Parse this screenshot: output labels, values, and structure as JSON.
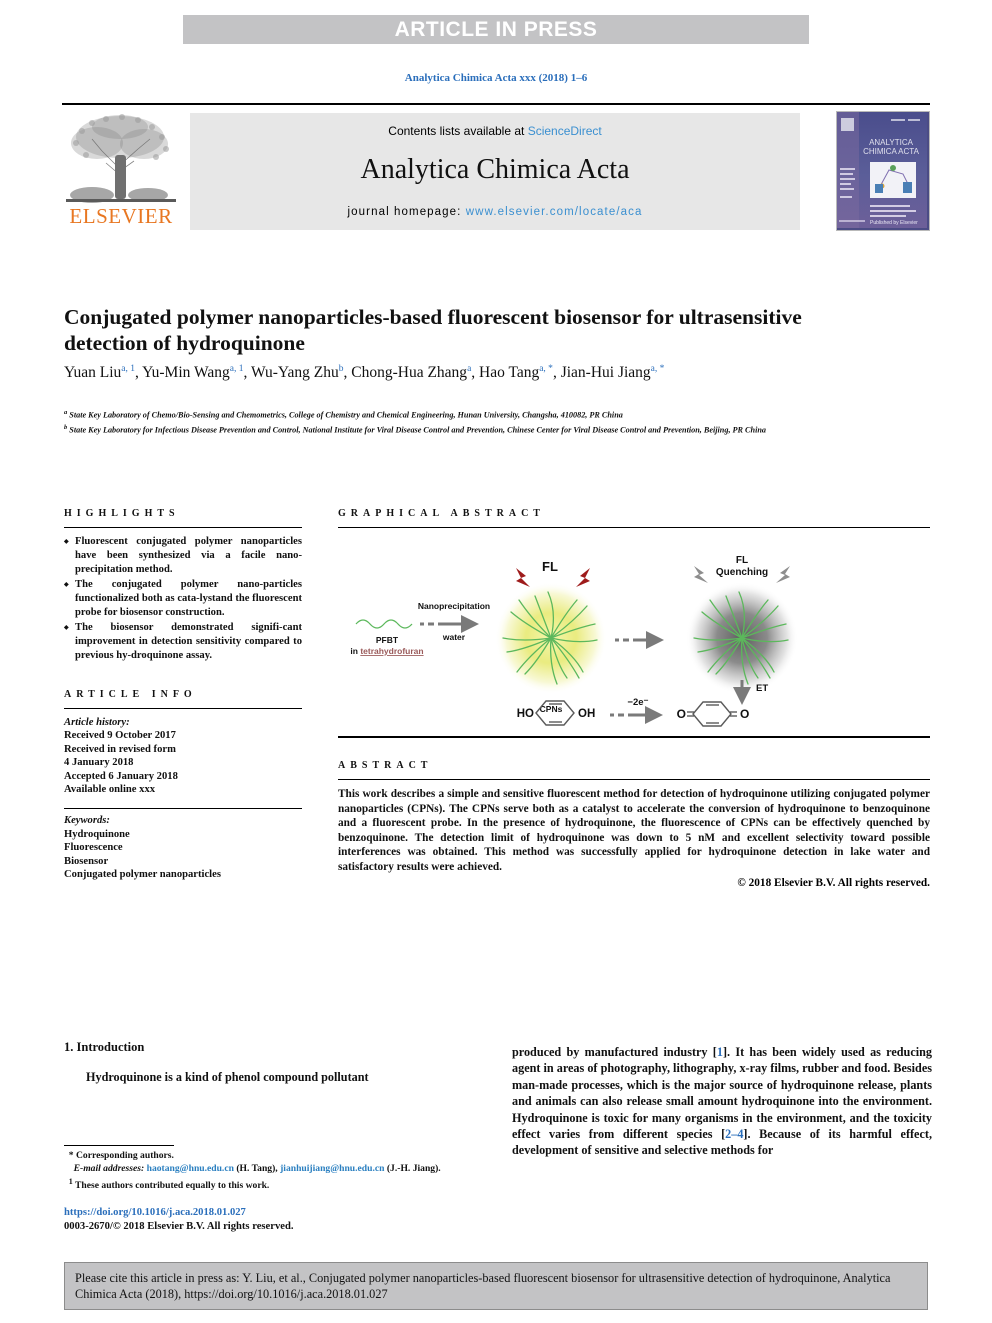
{
  "press_banner": "ARTICLE IN PRESS",
  "journal_ref": "Analytica Chimica Acta xxx (2018) 1–6",
  "masthead": {
    "publisher": "ELSEVIER",
    "contents_prefix": "Contents lists available at ",
    "contents_link": "ScienceDirect",
    "journal_title": "Analytica Chimica Acta",
    "homepage_prefix": "journal homepage: ",
    "homepage_url": "www.elsevier.com/locate/aca",
    "cover_title_line1": "ANALYTICA",
    "cover_title_line2": "CHIMICA ACTA"
  },
  "article": {
    "title": "Conjugated polymer nanoparticles-based fluorescent biosensor for ultrasensitive detection of hydroquinone",
    "authors": [
      {
        "name": "Yuan Liu",
        "marks": "a, 1",
        "sep": ", "
      },
      {
        "name": "Yu-Min Wang",
        "marks": "a, 1",
        "sep": ", "
      },
      {
        "name": "Wu-Yang Zhu",
        "marks": "b",
        "sep": ", "
      },
      {
        "name": "Chong-Hua Zhang",
        "marks": "a",
        "sep": ", "
      },
      {
        "name": "Hao Tang",
        "marks": "a, *",
        "sep": ", "
      },
      {
        "name": "Jian-Hui Jiang",
        "marks": "a, *",
        "sep": ""
      }
    ],
    "affiliations": [
      {
        "mark": "a",
        "text": "State Key Laboratory of Chemo/Bio-Sensing and Chemometrics, College of Chemistry and Chemical Engineering, Hunan University, Changsha, 410082, PR China"
      },
      {
        "mark": "b",
        "text": "State Key Laboratory for Infectious Disease Prevention and Control, National Institute for Viral Disease Control and Prevention, Chinese Center for Viral Disease Control and Prevention, Beijing, PR China"
      }
    ]
  },
  "highlights": {
    "heading": "HIGHLIGHTS",
    "items": [
      "Fluorescent conjugated polymer nanoparticles have been synthesized via a facile nano-precipitation method.",
      "The conjugated polymer nano-particles functionalized both as cata-lystand the fluorescent probe for biosensor construction.",
      "The biosensor demonstrated signifi-cant improvement in detection sensitivity compared to previous hy-droquinone assay."
    ]
  },
  "article_info": {
    "heading": "ARTICLE INFO",
    "history_label": "Article history:",
    "history": [
      "Received 9 October 2017",
      "Received in revised form",
      "4 January 2018",
      "Accepted 6 January 2018",
      "Available online xxx"
    ],
    "keywords_label": "Keywords:",
    "keywords": [
      "Hydroquinone",
      "Fluorescence",
      "Biosensor",
      "Conjugated polymer nanoparticles"
    ]
  },
  "graphical_abstract": {
    "heading": "GRAPHICAL ABSTRACT",
    "labels": {
      "fl": "FL",
      "fl_quenching_line1": "FL",
      "fl_quenching_line2": "Quenching",
      "nanoprecipitation": "Nanoprecipitation",
      "water": "water",
      "pfbt": "PFBT",
      "pfbt_solvent_prefix": "in ",
      "pfbt_solvent": "tetrahydrofuran",
      "cpns": "CPNs",
      "et": "ET",
      "electrons": "−2e⁻",
      "ho_left": "HO",
      "oh_right": "OH",
      "o_left": "O",
      "o_right": "O"
    }
  },
  "abstract": {
    "heading": "ABSTRACT",
    "text": "This work describes a simple and sensitive fluorescent method for detection of hydroquinone utilizing conjugated polymer nanoparticles (CPNs). The CPNs serve both as a catalyst to accelerate the conversion of hydroquinone to benzoquinone and a fluorescent probe. In the presence of hydroquinone, the fluorescence of CPNs can be effectively quenched by benzoquinone. The detection limit of hydroquinone was down to 5 nM and excellent selectivity toward possible interferences was obtained. This method was successfully applied for hydroquinone detection in lake water and satisfactory results were achieved.",
    "copyright": "© 2018 Elsevier B.V. All rights reserved."
  },
  "introduction": {
    "section_number_title": "1. Introduction",
    "left_paragraph": "Hydroquinone is a kind of phenol compound pollutant",
    "right_paragraph_part1": "produced by manufactured industry [",
    "right_ref1": "1",
    "right_paragraph_part2": "]. It has been widely used as reducing agent in areas of photography, lithography, x-ray films, rubber and food. Besides man-made processes, which is the major source of hydroquinone release, plants and animals can also release small amount hydroquinone into the environment. Hydroquinone is toxic for many organisms in the environment, and the toxicity effect varies from different species [",
    "right_ref2": "2–4",
    "right_paragraph_part3": "]. Because of its harmful effect, development of sensitive and selective methods for"
  },
  "footnotes": {
    "corresponding": "Corresponding authors.",
    "email_label": "E-mail addresses:",
    "email1": "haotang@hnu.edu.cn",
    "email1_owner": "(H. Tang)",
    "email2": "jianhuijiang@hnu.edu.cn",
    "email2_owner": "(J.-H. Jiang).",
    "equal_contrib": "These authors contributed equally to this work.",
    "doi": "https://doi.org/10.1016/j.aca.2018.01.027",
    "issn_copyright": "0003-2670/© 2018 Elsevier B.V. All rights reserved."
  },
  "citation_box": {
    "text": "Please cite this article in press as: Y. Liu, et al., Conjugated polymer nanoparticles-based fluorescent biosensor for ultrasensitive detection of hydroquinone, Analytica Chimica Acta (2018), https://doi.org/10.1016/j.aca.2018.01.027"
  },
  "colors": {
    "band_gray": "#c3c3c5",
    "link_blue": "#2a6ebb",
    "sd_blue": "#3a8fd0",
    "elsevier_orange": "#e87722",
    "masthead_gray": "#e7e7e7",
    "cpn_yellow": "#e6e86a",
    "chain_green": "#5cb85c",
    "arrow_gray": "#7a7a7a",
    "bolt_red": "#9e1b1b"
  }
}
